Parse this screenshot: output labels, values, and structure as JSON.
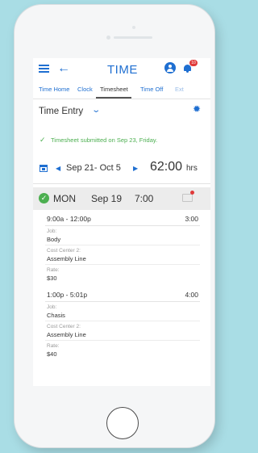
{
  "app": {
    "title": "TIME",
    "notification_count": "10"
  },
  "tabs": [
    {
      "label": "Time Home"
    },
    {
      "label": "Clock"
    },
    {
      "label": "Timesheet"
    },
    {
      "label": "Time Off"
    },
    {
      "label": "Ext"
    }
  ],
  "section": {
    "title": "Time Entry"
  },
  "notice": {
    "text": "Timesheet submitted on Sep 23, Friday."
  },
  "period": {
    "range": "Sep 21- Oct 5",
    "total": "62:00",
    "unit": "hrs"
  },
  "day": {
    "name": "MON",
    "date": "Sep 19",
    "total": "7:00"
  },
  "entries": [
    {
      "range": "9:00a - 12:00p",
      "hours": "3:00",
      "fields": [
        {
          "label": "Job:",
          "value": "Body"
        },
        {
          "label": "Cost Center 2:",
          "value": "Assembly Line"
        },
        {
          "label": "Rate:",
          "value": "$30"
        }
      ]
    },
    {
      "range": "1:00p - 5:01p",
      "hours": "4:00",
      "fields": [
        {
          "label": "Job:",
          "value": "Chasis"
        },
        {
          "label": "Cost Center 2:",
          "value": "Assembly Line"
        },
        {
          "label": "Rate:",
          "value": "$40"
        }
      ]
    }
  ],
  "colors": {
    "accent": "#1f6fd1",
    "success": "#4caf50",
    "alert": "#e03a3a",
    "background": "#a9dde5"
  },
  "icons": [
    "menu-icon",
    "back-arrow-icon",
    "user-icon",
    "bell-icon",
    "chevron-down-icon",
    "gear-icon",
    "check-icon",
    "calendar-icon",
    "prev-arrow-icon",
    "next-arrow-icon",
    "check-circle-icon",
    "comment-icon"
  ]
}
